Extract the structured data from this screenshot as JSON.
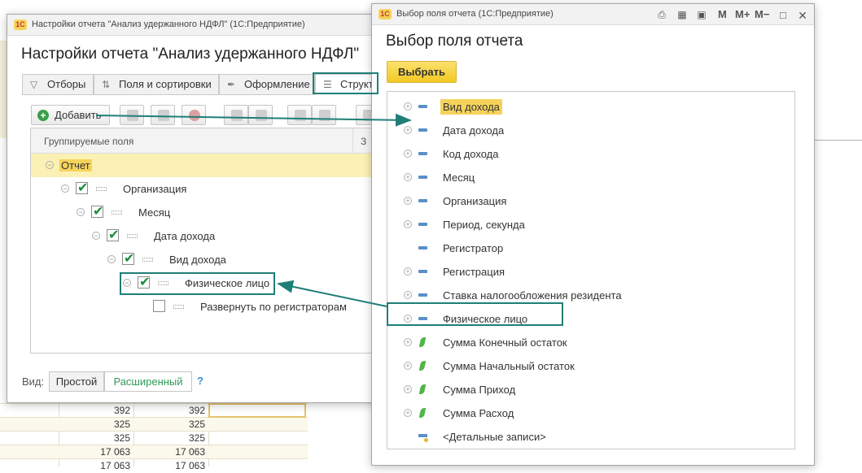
{
  "background": {
    "rows": [
      {
        "a": "392",
        "b": "392"
      },
      {
        "a": "325",
        "b": "325"
      },
      {
        "a": "325",
        "b": "325"
      },
      {
        "a": "17 063",
        "b": "17 063"
      },
      {
        "a": "17 063",
        "b": "17 063"
      }
    ]
  },
  "settings_window": {
    "title": "Настройки отчета \"Анализ удержанного НДФЛ\"  (1С:Предприятие)",
    "heading": "Настройки отчета \"Анализ удержанного НДФЛ\"",
    "tabs": [
      "Отборы",
      "Поля и сортировки",
      "Оформление",
      "Структ"
    ],
    "add_button": "Добавить",
    "tree_header": "Группируемые поля",
    "tree_header_col2": "З",
    "tree_rows": [
      {
        "label": "Отчет",
        "checked": null
      },
      {
        "label": "Организация",
        "checked": true
      },
      {
        "label": "Месяц",
        "checked": true
      },
      {
        "label": "Дата дохода",
        "checked": true
      },
      {
        "label": "Вид дохода",
        "checked": true
      },
      {
        "label": "Физическое лицо",
        "checked": true
      },
      {
        "label": "Развернуть по регистраторам",
        "checked": false
      }
    ],
    "view_label": "Вид:",
    "view_simple": "Простой",
    "view_extended": "Расширенный",
    "help": "?"
  },
  "selector_window": {
    "title": "Выбор поля отчета  (1С:Предприятие)",
    "heading": "Выбор поля отчета",
    "title_buttons": [
      "M",
      "M+",
      "M−"
    ],
    "select_button": "Выбрать",
    "fields": [
      {
        "label": "Вид дохода",
        "expandable": true,
        "icon": "dimension-icon"
      },
      {
        "label": "Дата дохода",
        "expandable": true,
        "icon": "dimension-icon"
      },
      {
        "label": "Код дохода",
        "expandable": true,
        "icon": "dimension-icon"
      },
      {
        "label": "Месяц",
        "expandable": true,
        "icon": "dimension-icon"
      },
      {
        "label": "Организация",
        "expandable": true,
        "icon": "dimension-icon"
      },
      {
        "label": "Период, секунда",
        "expandable": true,
        "icon": "dimension-icon"
      },
      {
        "label": "Регистратор",
        "expandable": false,
        "icon": "dimension-icon"
      },
      {
        "label": "Регистрация",
        "expandable": true,
        "icon": "dimension-icon"
      },
      {
        "label": "Ставка налогообложения резидента",
        "expandable": true,
        "icon": "dimension-icon"
      },
      {
        "label": "Физическое лицо",
        "expandable": true,
        "icon": "dimension-icon"
      },
      {
        "label": "Сумма Конечный остаток",
        "expandable": true,
        "icon": "resource-icon"
      },
      {
        "label": "Сумма Начальный остаток",
        "expandable": true,
        "icon": "resource-icon"
      },
      {
        "label": "Сумма Приход",
        "expandable": true,
        "icon": "resource-icon"
      },
      {
        "label": "Сумма Расход",
        "expandable": true,
        "icon": "resource-icon"
      },
      {
        "label": "<Детальные записи>",
        "expandable": false,
        "icon": "detail-records-icon"
      }
    ]
  },
  "colors": {
    "accent_yellow": "#f5d35b",
    "annotation_teal": "#1f7f77",
    "checkbox_green": "#1a8c3a",
    "extended_link": "#2e9a55"
  }
}
